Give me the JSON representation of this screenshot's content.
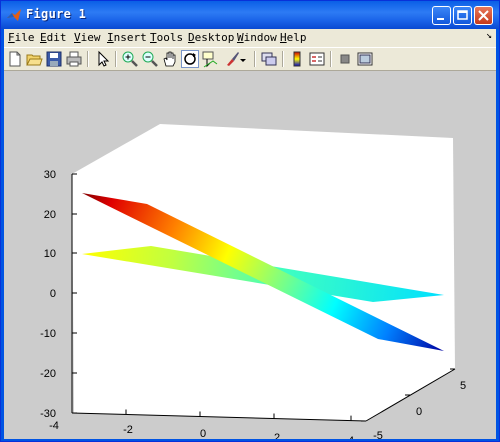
{
  "window": {
    "title": "Figure 1"
  },
  "menus": [
    {
      "key": "file",
      "accel": "F",
      "rest": "ile"
    },
    {
      "key": "edit",
      "accel": "E",
      "rest": "dit"
    },
    {
      "key": "view",
      "accel": "V",
      "rest": "iew"
    },
    {
      "key": "insert",
      "accel": "I",
      "rest": "nsert"
    },
    {
      "key": "tools",
      "accel": "T",
      "rest": "ools"
    },
    {
      "key": "desktop",
      "accel": "D",
      "rest": "esktop"
    },
    {
      "key": "window",
      "accel": "W",
      "rest": "indow"
    },
    {
      "key": "help",
      "accel": "H",
      "rest": "elp"
    }
  ],
  "toolbar_icons": [
    "new-figure-icon",
    "open-file-icon",
    "save-icon",
    "print-icon",
    "edit-plot-arrow-icon",
    "zoom-in-icon",
    "zoom-out-icon",
    "pan-hand-icon",
    "rotate-3d-icon",
    "data-cursor-icon",
    "brush-icon",
    "link-plot-icon",
    "colorbar-icon",
    "legend-icon",
    "hide-plot-tools-icon",
    "show-plot-tools-icon"
  ],
  "axes": {
    "z_ticks": [
      "30",
      "20",
      "10",
      "0",
      "-10",
      "-20",
      "-30"
    ],
    "x_ticks": [
      "-4",
      "-2",
      "0",
      "2",
      "4"
    ],
    "y_ticks": [
      "5",
      "0",
      "-5"
    ]
  }
}
